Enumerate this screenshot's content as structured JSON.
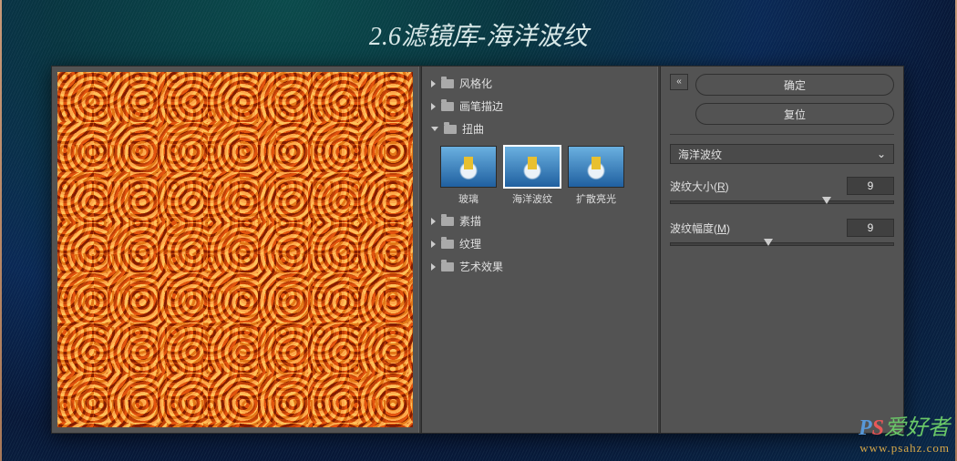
{
  "title": "2.6滤镜库-海洋波纹",
  "categories": {
    "c0": {
      "label": "风格化",
      "expanded": false
    },
    "c1": {
      "label": "画笔描边",
      "expanded": false
    },
    "c2": {
      "label": "扭曲",
      "expanded": true
    },
    "c3": {
      "label": "素描",
      "expanded": false
    },
    "c4": {
      "label": "纹理",
      "expanded": false
    },
    "c5": {
      "label": "艺术效果",
      "expanded": false
    }
  },
  "thumbs": {
    "t0": {
      "label": "玻璃",
      "selected": false
    },
    "t1": {
      "label": "海洋波纹",
      "selected": true
    },
    "t2": {
      "label": "扩散亮光",
      "selected": false
    }
  },
  "buttons": {
    "ok": "确定",
    "reset": "复位"
  },
  "collapse_glyph": "«",
  "dropdown": {
    "selected": "海洋波纹",
    "chevron": "⌄"
  },
  "params": {
    "ripple_size": {
      "label_pre": "波纹大小(",
      "hotkey": "R",
      "label_post": ")",
      "value": "9",
      "pos_pct": 68
    },
    "ripple_mag": {
      "label_pre": "波纹幅度(",
      "hotkey": "M",
      "label_post": ")",
      "value": "9",
      "pos_pct": 42
    }
  },
  "watermark": {
    "line1_ps_p": "P",
    "line1_ps_s": "S",
    "line1_rest": "爱好者",
    "line2": "www.psahz.com"
  }
}
